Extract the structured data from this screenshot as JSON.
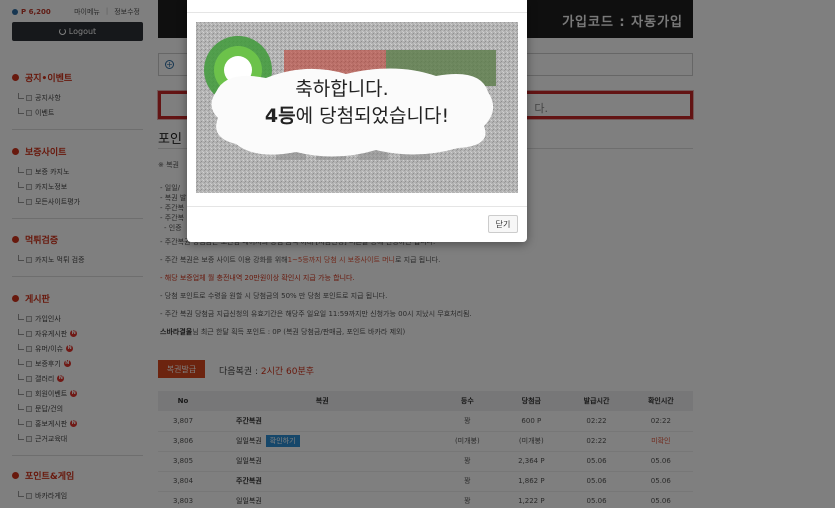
{
  "topbar": {
    "points": "P 6,200",
    "mypage": "마이메뉴",
    "edit_info": "정보수정",
    "logout": "Logout"
  },
  "sidebar": {
    "sections": [
      {
        "title": "공지•이벤트",
        "items": [
          {
            "label": "공지사항"
          },
          {
            "label": "이벤트"
          }
        ]
      },
      {
        "title": "보증사이트",
        "items": [
          {
            "label": "보증 카지노"
          },
          {
            "label": "카지노정보"
          },
          {
            "label": "모든사이트평가"
          }
        ]
      },
      {
        "title": "먹튀검증",
        "items": [
          {
            "label": "카지노 먹튀 검증"
          }
        ]
      },
      {
        "title": "게시판",
        "items": [
          {
            "label": "가입인사"
          },
          {
            "label": "자유게시판",
            "new": "N"
          },
          {
            "label": "유머/이슈",
            "new": "N"
          },
          {
            "label": "보증후기",
            "new": "N"
          },
          {
            "label": "갤러리",
            "new": "N"
          },
          {
            "label": "회원이벤트",
            "new": "N"
          },
          {
            "label": "문답/건의"
          },
          {
            "label": "홍보게시판",
            "new": "N"
          },
          {
            "label": "근거교육대"
          }
        ]
      },
      {
        "title": "포인트&게임",
        "items": [
          {
            "label": "바카라게임"
          }
        ]
      }
    ]
  },
  "banner": {
    "code": "가입코드 : 자동가입"
  },
  "notice": {
    "tail": "다."
  },
  "page": {
    "title": "포인",
    "sub": "※ 복권"
  },
  "rules": [
    "- 일일/",
    "- 복권 발",
    "- 주간복",
    "- 주간복",
    "- 인증",
    "- 주간복권 당첨금은 보관함 페이지의 당첨 금액 아래 [지금신청] 버튼을 통해 신청하면 됩니다.",
    "- 주간 복권은 보증 사이트 이용 강화를 위해 ",
    "1~5등까지 당첨 시 보증사이트 머니",
    "로 지급 됩니다.",
    "- 해당 보증업체 월 충전내역 20만원이상 확인시 지급 가능 합니다.",
    "- 당첨 포인트로 수령을 원할 시 당첨금의 50% 만 당첨 포인트로 지급 됩니다.",
    "- 주간 복권 당첨금 지급신청의 유효기간은 해당주 일요일 11:59까지만 신청가능 00시 지났시 무효처리됨.",
    "스바라결울",
    "님 최근 한달 획득 포인트 : 0P (복권 당첨금/판매금, 포인트 바카라 제외)"
  ],
  "lotto_button": "복권발급",
  "next": {
    "label": "다음복권 : ",
    "value": "2시간 60분후"
  },
  "table": {
    "headers": [
      "No",
      "복권",
      "등수",
      "당첨금",
      "발급시간",
      "확인시간"
    ],
    "rows": [
      {
        "no": "3,807",
        "type": "주간복권",
        "bold": true,
        "rank": "꽝",
        "prize": "600 P",
        "issued": "02:22",
        "checked": "02:22"
      },
      {
        "no": "3,806",
        "type": "일일복권",
        "tag": "확인하기",
        "rank": "(미개봉)",
        "prize": "(미개봉)",
        "issued": "02:22",
        "checked": "미확인"
      },
      {
        "no": "3,805",
        "type": "일일복권",
        "rank": "꽝",
        "prize": "2,364 P",
        "issued": "05.06",
        "checked": "05.06"
      },
      {
        "no": "3,804",
        "type": "주간복권",
        "bold": true,
        "rank": "꽝",
        "prize": "1,862 P",
        "issued": "05.06",
        "checked": "05.06"
      },
      {
        "no": "3,803",
        "type": "일일복권",
        "rank": "꽝",
        "prize": "1,222 P",
        "issued": "05.06",
        "checked": "05.06"
      }
    ]
  },
  "modal": {
    "line1": "축하합니다.",
    "rank": "4등",
    "line2": "에 당첨되었습니다!",
    "close": "닫기"
  },
  "colors": {
    "accent": "#d0321a",
    "button_orange": "#d9481f",
    "tag_blue": "#2d8fd4"
  }
}
